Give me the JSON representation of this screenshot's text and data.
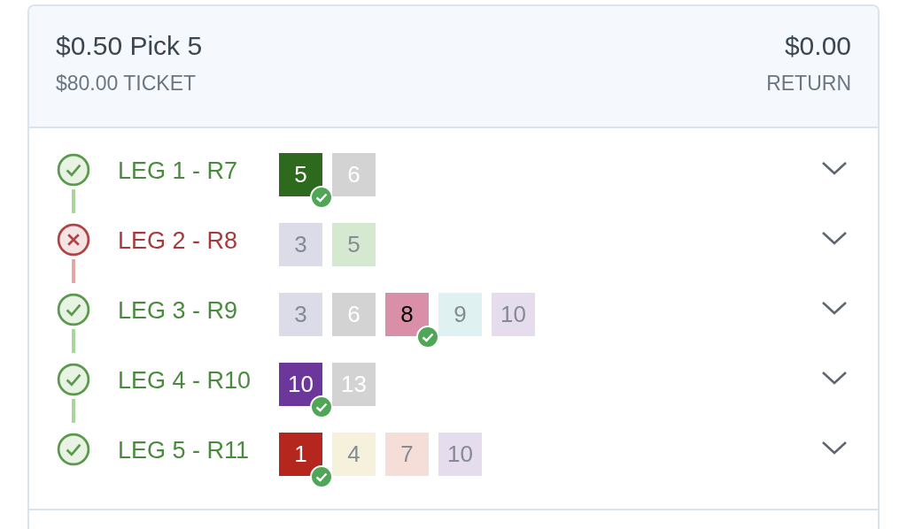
{
  "ticket": {
    "title": "$0.50 Pick 5",
    "subtitle": "$80.00 TICKET",
    "amount": "$0.00",
    "amount_label": "RETURN"
  },
  "legs": [
    {
      "label": "LEG 1 - R7",
      "won": true,
      "expanded": false,
      "runners": [
        {
          "number": "5",
          "color": "#2e6a1e",
          "winner": true
        },
        {
          "number": "6",
          "color": "#d3d3d3",
          "winner": false
        }
      ]
    },
    {
      "label": "LEG 2 - R8",
      "won": false,
      "expanded": false,
      "runners": [
        {
          "number": "3",
          "color": "#dcdce8",
          "winner": false
        },
        {
          "number": "5",
          "color": "#d5e8d0",
          "winner": false
        }
      ]
    },
    {
      "label": "LEG 3 - R9",
      "won": true,
      "expanded": false,
      "runners": [
        {
          "number": "3",
          "color": "#dcdce8",
          "winner": false
        },
        {
          "number": "6",
          "color": "#d3d3d3",
          "winner": false
        },
        {
          "number": "8",
          "color": "#d98fa8",
          "winner": true
        },
        {
          "number": "9",
          "color": "#dff1f0",
          "winner": false
        },
        {
          "number": "10",
          "color": "#e5dcee",
          "winner": false
        }
      ]
    },
    {
      "label": "LEG 4 - R10",
      "won": true,
      "expanded": false,
      "runners": [
        {
          "number": "10",
          "color": "#6b379b",
          "winner": true
        },
        {
          "number": "13",
          "color": "#d3d3d3",
          "winner": false
        }
      ]
    },
    {
      "label": "LEG 5 - R11",
      "won": true,
      "expanded": false,
      "runners": [
        {
          "number": "1",
          "color": "#b5261f",
          "winner": true
        },
        {
          "number": "4",
          "color": "#f5f1dc",
          "winner": false
        },
        {
          "number": "7",
          "color": "#f5ded8",
          "winner": false
        },
        {
          "number": "10",
          "color": "#e5dcee",
          "winner": false
        }
      ]
    }
  ]
}
